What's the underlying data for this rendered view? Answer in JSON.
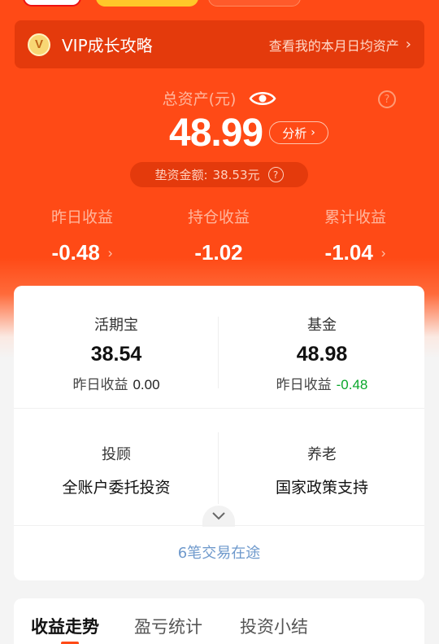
{
  "vip": {
    "title": "VIP成长攻略",
    "link": "查看我的本月日均资产",
    "icon": "vip-badge-icon",
    "icon_text": "V"
  },
  "total": {
    "label": "总资产(元)",
    "value": "48.99",
    "analyze": "分析",
    "advance_label": "垫资金额:",
    "advance_value": "38.53元"
  },
  "stats": [
    {
      "label": "昨日收益",
      "value": "-0.48"
    },
    {
      "label": "持仓收益",
      "value": "-1.02"
    },
    {
      "label": "累计收益",
      "value": "-1.04"
    }
  ],
  "products": {
    "huoqibao": {
      "title": "活期宝",
      "amount": "38.54",
      "yest_label": "昨日收益",
      "yest_value": "0.00"
    },
    "fund": {
      "title": "基金",
      "amount": "48.98",
      "yest_label": "昨日收益",
      "yest_value": "-0.48"
    },
    "advisory": {
      "title": "投顾",
      "desc": "全账户委托投资"
    },
    "pension": {
      "title": "养老",
      "desc": "国家政策支持"
    }
  },
  "transit": "6笔交易在途",
  "tabs": [
    {
      "label": "收益走势",
      "active": true
    },
    {
      "label": "盈亏统计",
      "active": false
    },
    {
      "label": "投资小结",
      "active": false
    }
  ],
  "colors": {
    "brand": "#ff4a16",
    "loss": "#0aa72b",
    "link": "#6e99cc"
  }
}
